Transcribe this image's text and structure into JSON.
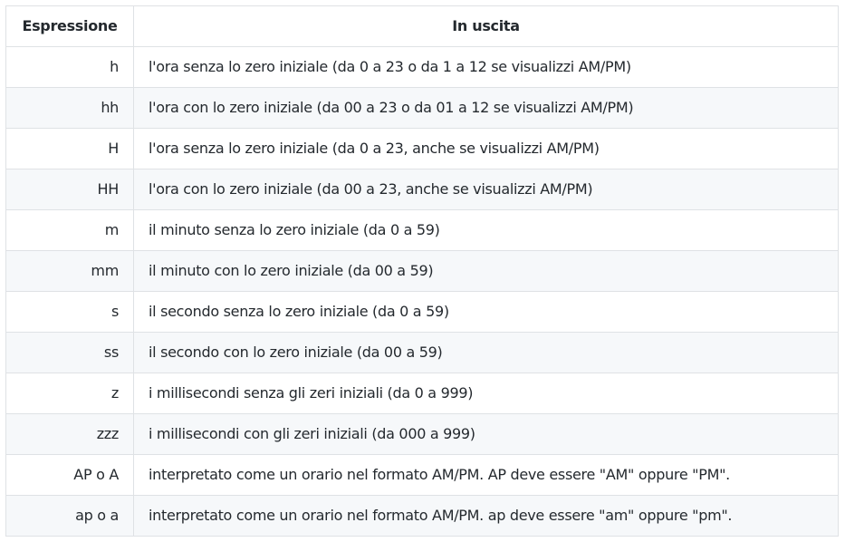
{
  "table": {
    "headers": [
      "Espressione",
      "In uscita"
    ],
    "rows": [
      {
        "expr": "h",
        "output": "l'ora senza lo zero iniziale (da 0 a 23 o da 1 a 12 se visualizzi AM/PM)"
      },
      {
        "expr": "hh",
        "output": "l'ora con lo zero iniziale (da 00 a 23 o da 01 a 12 se visualizzi AM/PM)"
      },
      {
        "expr": "H",
        "output": "l'ora senza lo zero iniziale (da 0 a 23, anche se visualizzi AM/PM)"
      },
      {
        "expr": "HH",
        "output": "l'ora con lo zero iniziale (da 00 a 23, anche se visualizzi AM/PM)"
      },
      {
        "expr": "m",
        "output": "il minuto senza lo zero iniziale (da 0 a 59)"
      },
      {
        "expr": "mm",
        "output": "il minuto con lo zero iniziale (da 00 a 59)"
      },
      {
        "expr": "s",
        "output": "il secondo senza lo zero iniziale (da 0 a 59)"
      },
      {
        "expr": "ss",
        "output": "il secondo con lo zero iniziale (da 00 a 59)"
      },
      {
        "expr": "z",
        "output": "i millisecondi senza gli zeri iniziali (da 0 a 999)"
      },
      {
        "expr": "zzz",
        "output": "i millisecondi con gli zeri iniziali (da 000 a 999)"
      },
      {
        "expr": "AP o A",
        "output": "interpretato come un orario nel formato AM/PM. AP deve essere \"AM\" oppure \"PM\"."
      },
      {
        "expr": "ap o a",
        "output": "interpretato come un orario nel formato AM/PM. ap deve essere \"am\" oppure \"pm\"."
      }
    ]
  }
}
